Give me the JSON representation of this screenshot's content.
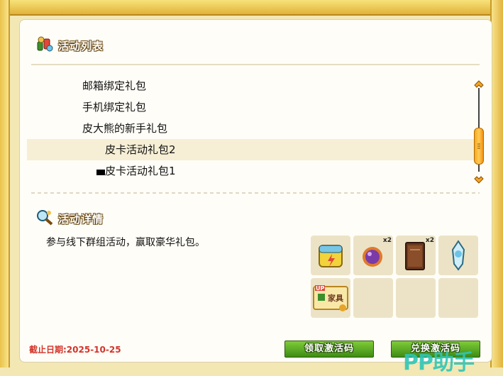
{
  "activity_list": {
    "title": "活动列表",
    "items": [
      {
        "label": "邮箱绑定礼包",
        "level": "top"
      },
      {
        "label": "手机绑定礼包",
        "level": "top"
      },
      {
        "label": "皮大熊的新手礼包",
        "level": "top"
      },
      {
        "label": "皮卡活动礼包2",
        "level": "sub",
        "selected": true
      },
      {
        "label": "皮卡活动礼包1",
        "level": "sub",
        "bullet": true
      }
    ]
  },
  "detail": {
    "title": "活动详情",
    "description": "参与线下群组活动，赢取豪华礼包。",
    "rewards": [
      {
        "icon": "battery-pack-icon",
        "count": ""
      },
      {
        "icon": "purple-orb-icon",
        "count": "x2"
      },
      {
        "icon": "book-icon",
        "count": "x2"
      },
      {
        "icon": "crystal-lantern-icon",
        "count": ""
      },
      {
        "icon": "furniture-card-icon",
        "count": "",
        "card_text": "家具",
        "badge": "UP"
      }
    ]
  },
  "deadline": "截止日期:2025-10-25",
  "buttons": {
    "claim": "领取激活码",
    "redeem": "兑换激活码"
  },
  "watermark": "PP助手",
  "colors": {
    "button_green": "#4a9c1a",
    "deadline_red": "#d2342a",
    "frame_gold": "#e9c24b",
    "scroll_orange": "#f5a623"
  }
}
